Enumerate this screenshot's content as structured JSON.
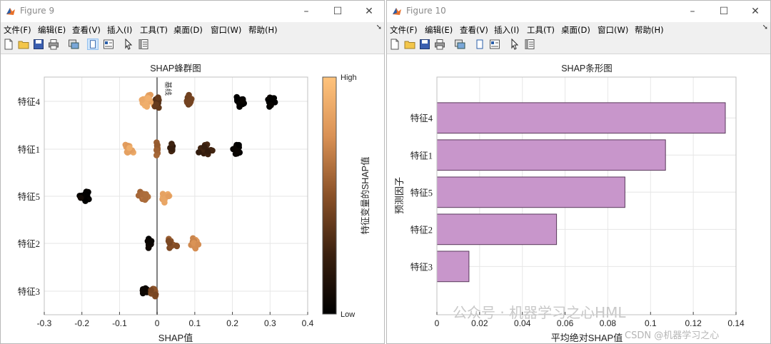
{
  "windows": [
    {
      "title": "Figure 9",
      "menus": [
        "文件(F)",
        "编辑(E)",
        "查看(V)",
        "插入(I)",
        "工具(T)",
        "桌面(D)",
        "窗口(W)",
        "帮助(H)"
      ]
    },
    {
      "title": "Figure 10",
      "menus": [
        "文件(F)",
        "编辑(E)",
        "查看(V)",
        "插入(I)",
        "工具(T)",
        "桌面(D)",
        "窗口(W)",
        "帮助(H)"
      ]
    }
  ],
  "window_controls": {
    "minimize": "–",
    "maximize": "☐",
    "close": "✕"
  },
  "toolbar_icons": [
    "new-file-icon",
    "open-folder-icon",
    "save-icon",
    "print-icon",
    "link-figure-icon",
    "dock-figure-icon",
    "panel-toggle-icon",
    "pointer-icon",
    "property-inspector-icon"
  ],
  "colors": {
    "bar_fill": "#c896cb",
    "bar_edge": "#5a3a5c",
    "zero_line": "#808080",
    "colormap_low": "#000000",
    "colormap_high": "#ffc37c"
  },
  "chart_data": [
    {
      "type": "scatter",
      "title": "SHAP蜂群图",
      "xlabel": "SHAP值",
      "ylabel": "",
      "xlim": [
        -0.3,
        0.4
      ],
      "xticks": [
        "-0.3",
        "-0.2",
        "-0.1",
        "0",
        "0.1",
        "0.2",
        "0.3",
        "0.4"
      ],
      "categories": [
        "特征4",
        "特征1",
        "特征5",
        "特征2",
        "特征3"
      ],
      "grid": true,
      "zero_line_label": "基线",
      "colorbar": {
        "label": "特征变量的SHAP值",
        "high": "High",
        "low": "Low"
      },
      "clusters": [
        {
          "feature": "特征4",
          "center": -0.03,
          "spread": 0.025,
          "n": 26,
          "color": 0.88
        },
        {
          "feature": "特征4",
          "center": 0.0,
          "spread": 0.012,
          "n": 12,
          "color": 0.35
        },
        {
          "feature": "特征4",
          "center": 0.085,
          "spread": 0.012,
          "n": 12,
          "color": 0.45
        },
        {
          "feature": "特征4",
          "center": 0.22,
          "spread": 0.02,
          "n": 14,
          "color": 0.02
        },
        {
          "feature": "特征4",
          "center": 0.3,
          "spread": 0.025,
          "n": 14,
          "color": 0.02
        },
        {
          "feature": "特征1",
          "center": -0.075,
          "spread": 0.015,
          "n": 14,
          "color": 0.85
        },
        {
          "feature": "特征1",
          "center": 0.0,
          "spread": 0.003,
          "n": 10,
          "color": 0.55
        },
        {
          "feature": "特征1",
          "center": 0.04,
          "spread": 0.012,
          "n": 6,
          "color": 0.22
        },
        {
          "feature": "特征1",
          "center": 0.13,
          "spread": 0.025,
          "n": 16,
          "color": 0.25
        },
        {
          "feature": "特征1",
          "center": 0.21,
          "spread": 0.015,
          "n": 12,
          "color": 0.04
        },
        {
          "feature": "特征5",
          "center": -0.19,
          "spread": 0.02,
          "n": 28,
          "color": 0.01
        },
        {
          "feature": "特征5",
          "center": -0.04,
          "spread": 0.022,
          "n": 18,
          "color": 0.6
        },
        {
          "feature": "特征5",
          "center": 0.02,
          "spread": 0.015,
          "n": 10,
          "color": 0.85
        },
        {
          "feature": "特征2",
          "center": -0.02,
          "spread": 0.008,
          "n": 16,
          "color": 0.03
        },
        {
          "feature": "特征2",
          "center": 0.04,
          "spread": 0.02,
          "n": 14,
          "color": 0.5
        },
        {
          "feature": "特征2",
          "center": 0.1,
          "spread": 0.015,
          "n": 14,
          "color": 0.72
        },
        {
          "feature": "特征3",
          "center": -0.03,
          "spread": 0.012,
          "n": 14,
          "color": 0.05
        },
        {
          "feature": "特征3",
          "center": -0.01,
          "spread": 0.012,
          "n": 14,
          "color": 0.45
        }
      ]
    },
    {
      "type": "bar",
      "orientation": "horizontal",
      "title": "SHAP条形图",
      "xlabel": "平均绝对SHAP值",
      "ylabel": "预测因子",
      "xlim": [
        0,
        0.14
      ],
      "xticks": [
        "0",
        "0.02",
        "0.04",
        "0.06",
        "0.08",
        "0.1",
        "0.12",
        "0.14"
      ],
      "categories": [
        "特征4",
        "特征1",
        "特征5",
        "特征2",
        "特征3"
      ],
      "values": [
        0.135,
        0.107,
        0.088,
        0.056,
        0.015
      ],
      "grid": true
    }
  ],
  "watermarks": {
    "wechat": "公众号 · 机器学习之心HML",
    "csdn": "CSDN @机器学习之心"
  }
}
